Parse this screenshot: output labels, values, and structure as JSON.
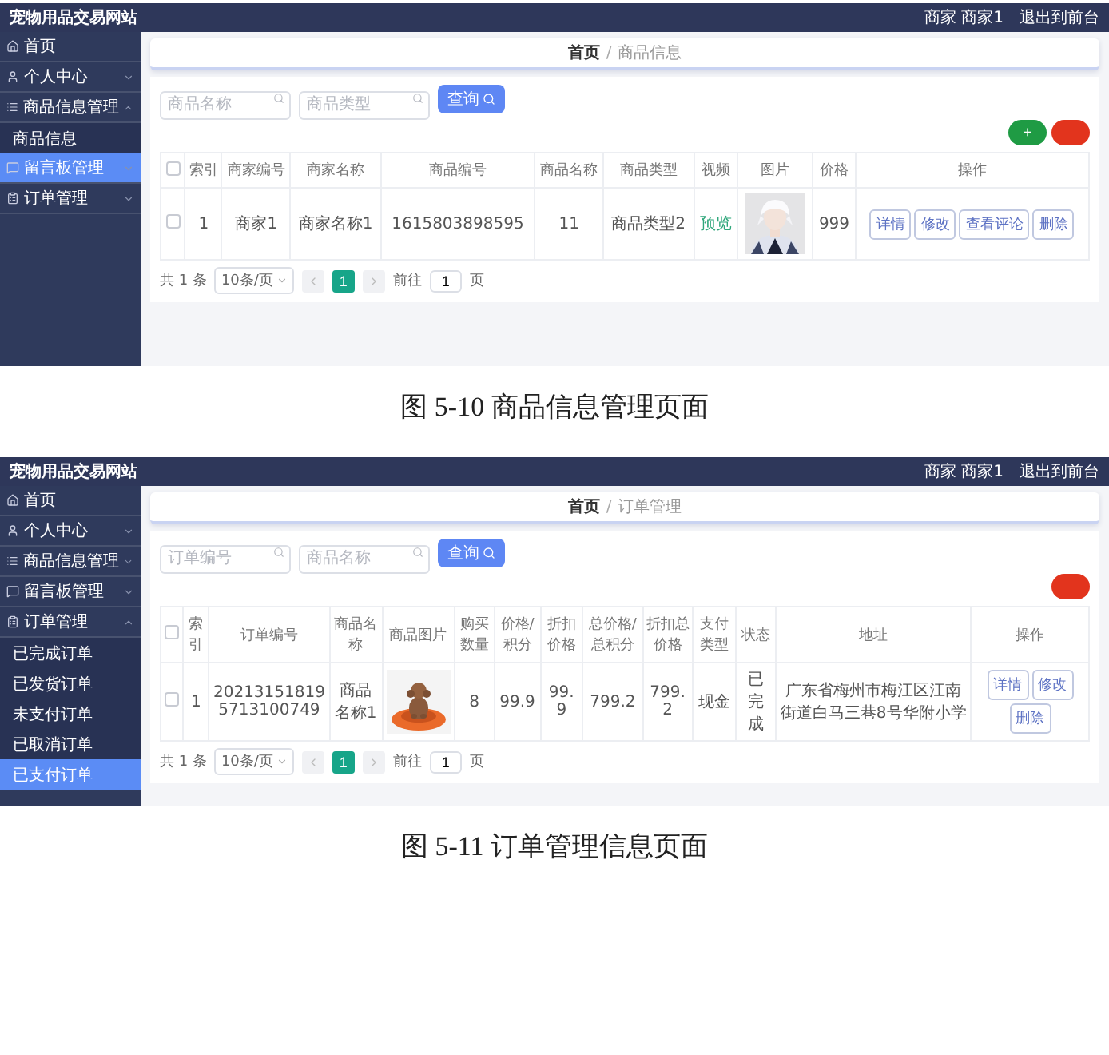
{
  "figures": [
    {
      "screen": {
        "title": "宠物用品交易网站",
        "header_links": [
          "商家 商家1",
          "退出到前台"
        ],
        "sidebar": [
          {
            "label": "首页",
            "selected": false
          },
          {
            "label": "个人中心",
            "selected": false,
            "expanded": false
          },
          {
            "label": "商品信息管理",
            "selected": false,
            "expanded": true,
            "children": [
              {
                "label": "商品信息",
                "selected": false
              }
            ]
          },
          {
            "label": "留言板管理",
            "selected": true,
            "expanded": false
          },
          {
            "label": "订单管理",
            "selected": false,
            "expanded": false
          }
        ],
        "breadcrumb": {
          "items": [
            "首页",
            "商品信息"
          ],
          "separator": "/"
        },
        "search": {
          "fields": [
            {
              "placeholder": "商品名称"
            },
            {
              "placeholder": "商品类型"
            }
          ],
          "button": "查询"
        },
        "toolbar": [
          {
            "kind": "add",
            "label": "+"
          },
          {
            "kind": "delete"
          }
        ],
        "table": {
          "columns": [
            {
              "kind": "checkbox",
              "checked": false
            },
            {
              "kind": "text",
              "label": "索引"
            },
            {
              "kind": "text",
              "label": "商家编号"
            },
            {
              "kind": "text",
              "label": "商家名称"
            },
            {
              "kind": "text",
              "label": "商品编号"
            },
            {
              "kind": "text",
              "label": "商品名称"
            },
            {
              "kind": "text",
              "label": "商品类型"
            },
            {
              "kind": "text",
              "label": "视频"
            },
            {
              "kind": "text",
              "label": "图片"
            },
            {
              "kind": "text",
              "label": "价格"
            },
            {
              "kind": "text",
              "label": "操作"
            }
          ],
          "rows": [
            {
              "cells": [
                {
                  "kind": "checkbox",
                  "checked": false
                },
                {
                  "kind": "text",
                  "text": "1"
                },
                {
                  "kind": "text",
                  "text": "商家1"
                },
                {
                  "kind": "text",
                  "text": "商家名称1"
                },
                {
                  "kind": "text",
                  "text": "1615803898595"
                },
                {
                  "kind": "text",
                  "text": "11"
                },
                {
                  "kind": "text",
                  "text": "商品类型2"
                },
                {
                  "kind": "link",
                  "text": "预览"
                },
                {
                  "kind": "picture"
                },
                {
                  "kind": "text",
                  "text": "999"
                },
                {
                  "kind": "actions",
                  "buttons": [
                    "详情",
                    "修改",
                    "查看评论",
                    "删除"
                  ]
                }
              ]
            }
          ]
        },
        "pagination": {
          "total": "共 1 条",
          "page_size": "10条/页",
          "pages": [
            {
              "label": "1",
              "selected": true
            }
          ],
          "goto": "前往",
          "goto_value": "1",
          "goto_suffix": "页"
        }
      },
      "caption": "图 5-10 商品信息管理页面"
    },
    {
      "screen": {
        "title": "宠物用品交易网站",
        "header_links": [
          "商家 商家1",
          "退出到前台"
        ],
        "sidebar": [
          {
            "label": "首页",
            "selected": false
          },
          {
            "label": "个人中心",
            "selected": false,
            "expanded": false
          },
          {
            "label": "商品信息管理",
            "selected": false,
            "expanded": false
          },
          {
            "label": "留言板管理",
            "selected": false,
            "expanded": false
          },
          {
            "label": "订单管理",
            "selected": false,
            "expanded": true,
            "children": [
              {
                "label": "已完成订单",
                "selected": false
              },
              {
                "label": "已发货订单",
                "selected": false
              },
              {
                "label": "未支付订单",
                "selected": false
              },
              {
                "label": "已取消订单",
                "selected": false
              },
              {
                "label": "已支付订单",
                "selected": true
              }
            ]
          }
        ],
        "breadcrumb": {
          "items": [
            "首页",
            "订单管理"
          ],
          "separator": "/"
        },
        "search": {
          "fields": [
            {
              "placeholder": "订单编号"
            },
            {
              "placeholder": "商品名称"
            }
          ],
          "button": "查询"
        },
        "toolbar": [
          {
            "kind": "delete"
          }
        ],
        "table": {
          "columns": [
            {
              "kind": "checkbox",
              "checked": false
            },
            {
              "kind": "text",
              "label": "索引"
            },
            {
              "kind": "text",
              "label": "订单编号"
            },
            {
              "kind": "text",
              "label": "商品名称"
            },
            {
              "kind": "text",
              "label": "商品图片"
            },
            {
              "kind": "text",
              "label": "购买数量"
            },
            {
              "kind": "text",
              "label": "价格/积分"
            },
            {
              "kind": "text",
              "label": "折扣价格"
            },
            {
              "kind": "text",
              "label": "总价格/总积分"
            },
            {
              "kind": "text",
              "label": "折扣总价格"
            },
            {
              "kind": "text",
              "label": "支付类型"
            },
            {
              "kind": "text",
              "label": "状态"
            },
            {
              "kind": "text",
              "label": "地址"
            },
            {
              "kind": "text",
              "label": "操作"
            }
          ],
          "rows": [
            {
              "cells": [
                {
                  "kind": "checkbox",
                  "checked": false
                },
                {
                  "kind": "text",
                  "text": "1"
                },
                {
                  "kind": "text",
                  "text": "202131518195713100749"
                },
                {
                  "kind": "text",
                  "text": "商品名称1"
                },
                {
                  "kind": "picture"
                },
                {
                  "kind": "text",
                  "text": "8"
                },
                {
                  "kind": "text",
                  "text": "99.9"
                },
                {
                  "kind": "text",
                  "text": "99.9"
                },
                {
                  "kind": "text",
                  "text": "799.2"
                },
                {
                  "kind": "text",
                  "text": "799.2"
                },
                {
                  "kind": "text",
                  "text": "现金"
                },
                {
                  "kind": "text",
                  "text": "已完成"
                },
                {
                  "kind": "text",
                  "text": "广东省梅州市梅江区江南街道白马三巷8号华附小学"
                },
                {
                  "kind": "actions",
                  "buttons": [
                    "详情",
                    "修改",
                    "删除"
                  ]
                }
              ]
            }
          ]
        },
        "pagination": {
          "total": "共 1 条",
          "page_size": "10条/页",
          "pages": [
            {
              "label": "1",
              "selected": true
            }
          ],
          "goto": "前往",
          "goto_value": "1",
          "goto_suffix": "页"
        }
      },
      "caption": "图 5-11 订单管理信息页面"
    }
  ]
}
